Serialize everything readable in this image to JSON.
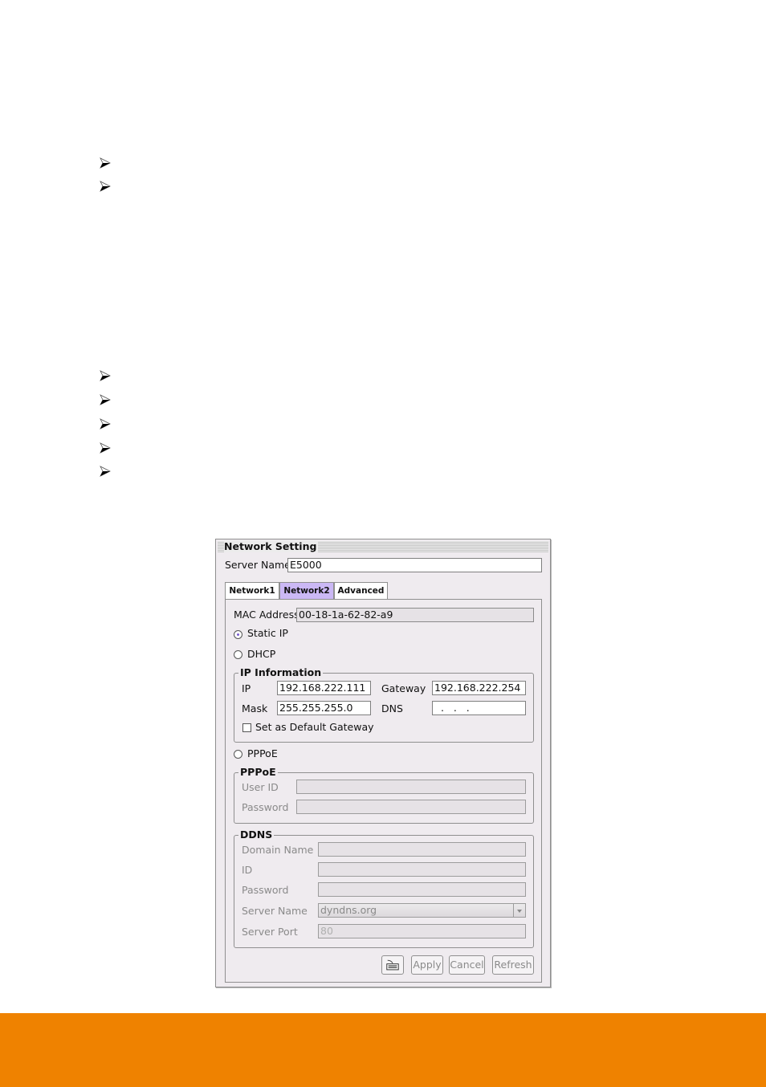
{
  "bullets": {
    "count_group1": 2,
    "count_group2": 5
  },
  "dialog": {
    "title": "Network Setting",
    "server_name_label": "Server Name",
    "server_name_value": "E5000",
    "tabs": [
      {
        "label": "Network1",
        "active": false
      },
      {
        "label": "Network2",
        "active": true
      },
      {
        "label": "Advanced",
        "active": false
      }
    ],
    "mac_label": "MAC Address",
    "mac_value": "00-18-1a-62-82-a9",
    "mode_options": [
      {
        "label": "Static IP",
        "selected": true
      },
      {
        "label": "DHCP",
        "selected": false
      },
      {
        "label": "PPPoE",
        "selected": false
      }
    ],
    "ip_info": {
      "title": "IP Information",
      "ip_label": "IP",
      "ip_value": "192.168.222.111",
      "gateway_label": "Gateway",
      "gateway_value": "192.168.222.254",
      "mask_label": "Mask",
      "mask_value": "255.255.255.0",
      "dns_label": "DNS",
      "dns_value": "  .   .   .",
      "default_gateway_label": "Set as Default Gateway",
      "default_gateway_checked": false
    },
    "pppoe": {
      "title": "PPPoE",
      "user_id_label": "User ID",
      "user_id_value": "",
      "password_label": "Password",
      "password_value": ""
    },
    "ddns": {
      "title": "DDNS",
      "domain_label": "Domain Name",
      "domain_value": "",
      "id_label": "ID",
      "id_value": "",
      "password_label": "Password",
      "password_value": "",
      "server_name_label": "Server Name",
      "server_name_value": "dyndns.org",
      "server_port_label": "Server Port",
      "server_port_value": "80"
    },
    "buttons": {
      "keyboard_icon": "keyboard-icon",
      "apply": "Apply",
      "cancel": "Cancel",
      "refresh": "Refresh"
    }
  },
  "colors": {
    "footer_band": "#ef8200",
    "active_tab": "#cbb8f5",
    "dialog_bg": "#efebef"
  }
}
